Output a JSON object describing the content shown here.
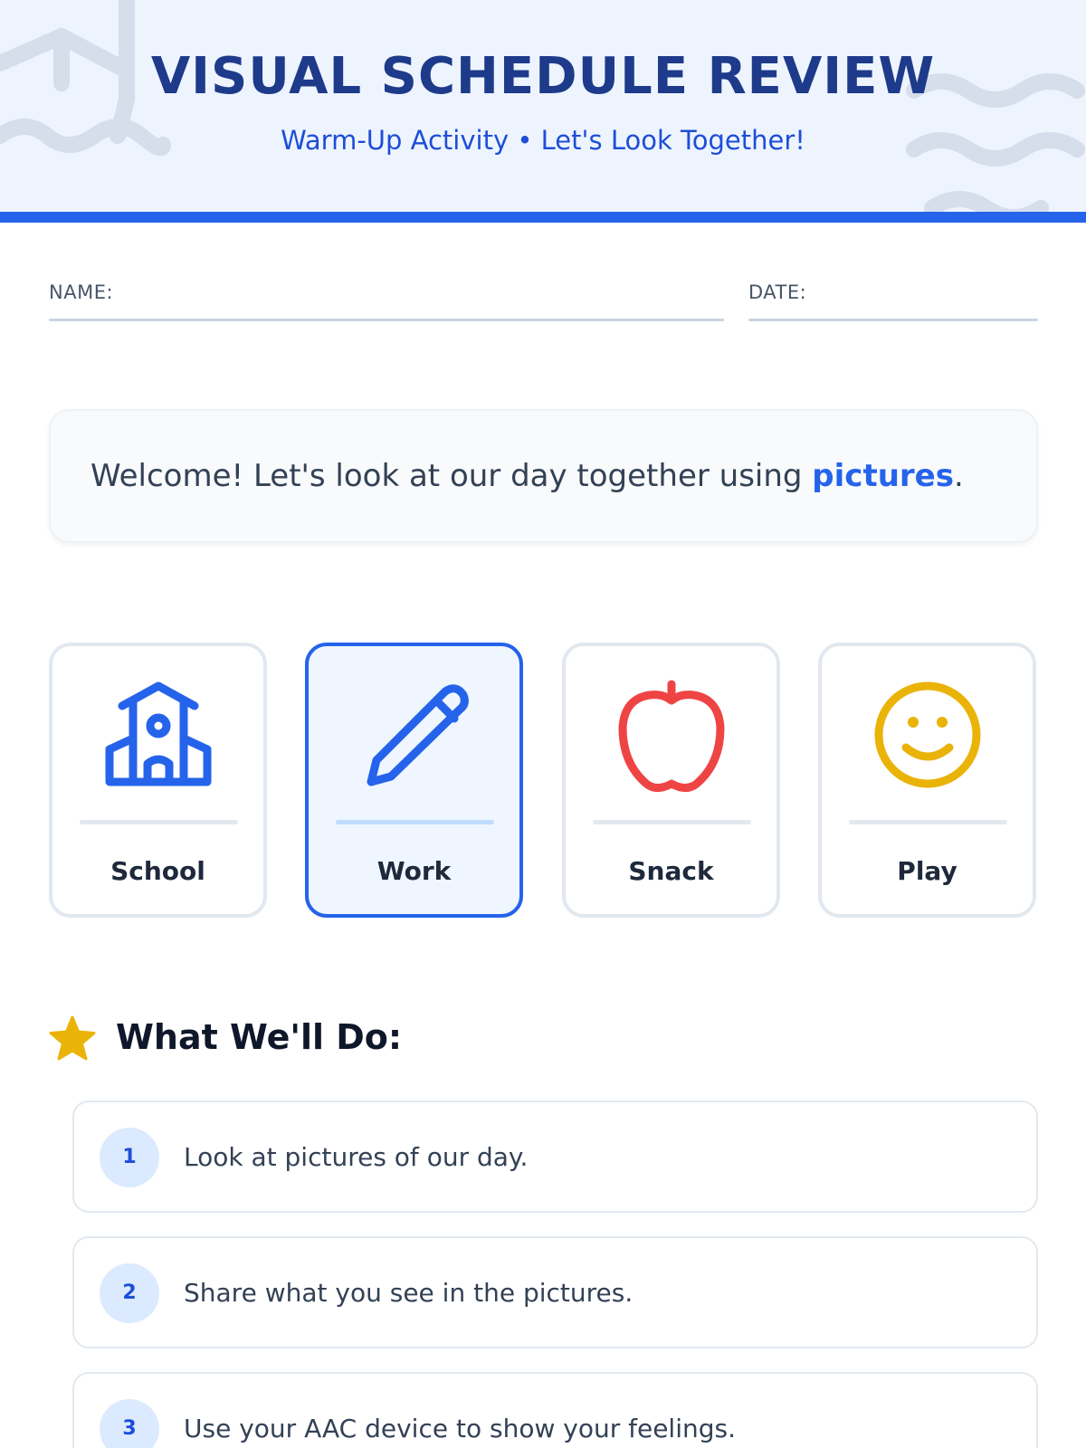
{
  "header": {
    "title": "VISUAL SCHEDULE REVIEW",
    "subtitle": "Warm-Up Activity • Let's Look Together!"
  },
  "form": {
    "name_label": "NAME:",
    "date_label": "DATE:"
  },
  "welcome": {
    "text_before": "Welcome! Let's look at our day together using ",
    "highlight": "pictures",
    "text_after": "."
  },
  "cards": [
    {
      "label": "School",
      "icon": "school-icon",
      "color": "#2563eb",
      "selected": false
    },
    {
      "label": "Work",
      "icon": "pencil-icon",
      "color": "#2563eb",
      "selected": true
    },
    {
      "label": "Snack",
      "icon": "apple-icon",
      "color": "#ef4444",
      "selected": false
    },
    {
      "label": "Play",
      "icon": "smiley-icon",
      "color": "#eab308",
      "selected": false
    }
  ],
  "section": {
    "title": "What We'll Do:",
    "icon": "star-icon",
    "icon_color": "#eab308"
  },
  "steps": [
    {
      "number": "1",
      "text": "Look at pictures of our day."
    },
    {
      "number": "2",
      "text": "Share what you see in the pictures."
    },
    {
      "number": "3",
      "text": "Use your AAC device to show your feelings."
    }
  ]
}
